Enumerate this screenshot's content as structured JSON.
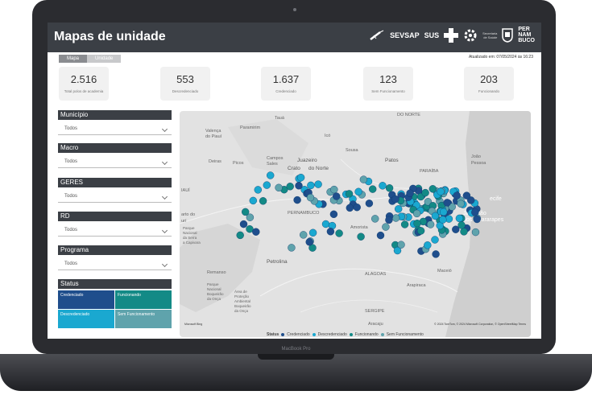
{
  "app": {
    "title": "Mapas de unidade",
    "device_label": "MacBook Pro"
  },
  "logos": {
    "sevsap": "SEVSAP",
    "sus": "SUS",
    "secretaria_line1": "Secretaria",
    "secretaria_line2": "de Saúde",
    "pe_line1": "PER",
    "pe_line2": "NAM",
    "pe_line3": "BUCO"
  },
  "tabs": [
    {
      "label": "Mapa",
      "active": true
    },
    {
      "label": "Unidade",
      "active": false
    }
  ],
  "updated": "Atualizado em: 07/05/2024 às 16:23",
  "kpis": [
    {
      "value": "2.516",
      "label": "Total polos de academia"
    },
    {
      "value": "553",
      "label": "Descredenciado"
    },
    {
      "value": "1.637",
      "label": "Credenciado"
    },
    {
      "value": "123",
      "label": "Sem Funcionamento"
    },
    {
      "value": "203",
      "label": "Funcionando"
    }
  ],
  "filters": [
    {
      "label": "Município",
      "value": "Todos"
    },
    {
      "label": "Macro",
      "value": "Todos"
    },
    {
      "label": "GERES",
      "value": "Todos"
    },
    {
      "label": "RD",
      "value": "Todos"
    },
    {
      "label": "Programa",
      "value": "Todos"
    }
  ],
  "status": {
    "header": "Status",
    "tiles": [
      {
        "label": "Credenciado",
        "color": "#1f4e8c"
      },
      {
        "label": "Funcionando",
        "color": "#138a86"
      },
      {
        "label": "Descredenciado",
        "color": "#1aa8d0"
      },
      {
        "label": "Sem Funcionamento",
        "color": "#5fa3ac"
      }
    ]
  },
  "map": {
    "place_labels": {
      "taua": "Tauá",
      "do_norte": "DO NORTE",
      "valenca": "Valença",
      "do_piaui": "do Piauí",
      "paramirim": "Paramirim",
      "ico": "Icó",
      "sousa": "Sousa",
      "joao": "João",
      "pessoa": "Pessoa",
      "patos": "Patos",
      "paraiba": "PARAÍBA",
      "piaui": "IAUÍ",
      "campos": "Campos",
      "sales": "Sales",
      "juazeiro": "Juazeiro",
      "crato": "Crato",
      "norte": "do Norte",
      "deiras": "Deiras",
      "picos": "Picos",
      "recife": "ecife",
      "jaboatao": "Jaboatão",
      "guararapes": "dos Guararapes",
      "pernambuco": "PERNAMBUCO",
      "caruaru": "ruaru",
      "amorista": "Amorista",
      "arto": "arto do",
      "uri": "urí",
      "parque": "Parque",
      "nacional": "Nacional",
      "serra": "da Serra",
      "capivara": "a Capivara",
      "petrolina": "Petrolina",
      "remanso": "Remanso",
      "parque2": "Parque",
      "nacional2": "Nacional",
      "boqueirao": "Boqueirão",
      "onca": "da Onça",
      "area": "Área de",
      "protecao": "Proteção",
      "ambiental": "Ambiental",
      "boqueirao2": "Boqueirão",
      "onca2": "da Onça",
      "alagoas": "ALAGOAS",
      "maceio": "Maceió",
      "arapiraca": "Arapiraca",
      "sergipe": "SERGIPE",
      "aracaju": "Aracaju"
    },
    "bing": "Microsoft Bing",
    "attribution": "© 2024 TomTom, © 2024 Microsoft Corporation, © OpenStreetMap  Terms",
    "legend": {
      "title": "Status",
      "items": [
        {
          "label": "Credenciado",
          "color": "#1f4e8c"
        },
        {
          "label": "Descredenciado",
          "color": "#1aa8d0"
        },
        {
          "label": "Funcionando",
          "color": "#138a86"
        },
        {
          "label": "Sem Funcionamento",
          "color": "#5fa3ac"
        }
      ]
    }
  }
}
